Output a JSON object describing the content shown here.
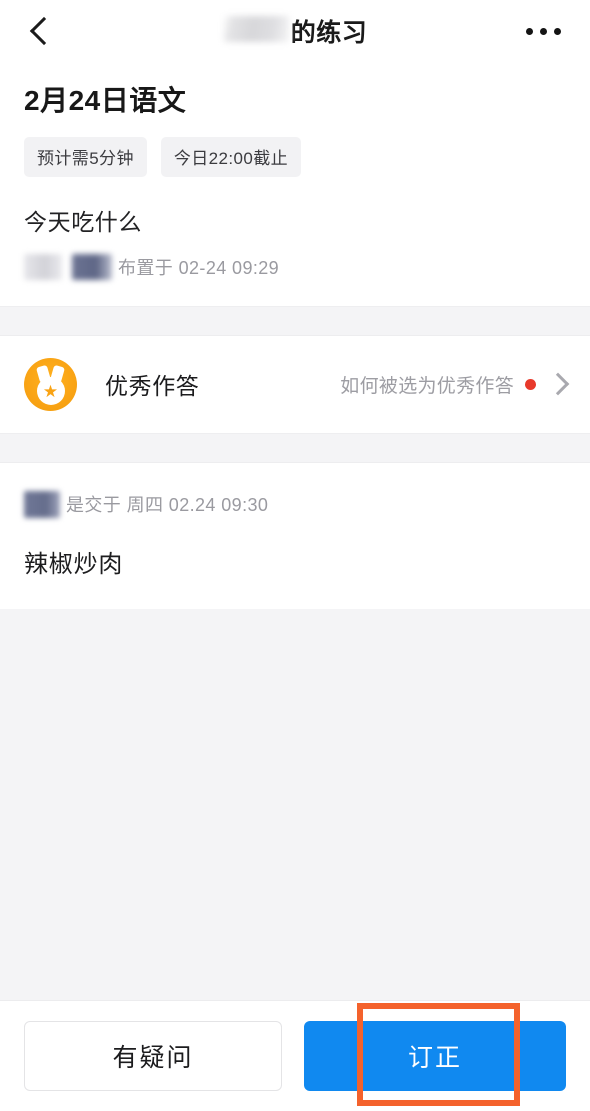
{
  "header": {
    "back_icon": "chevron-left-icon",
    "title_suffix": "的练习",
    "title_blurred_name": "",
    "more_icon": "more-horizontal-icon"
  },
  "assignment": {
    "title": "2月24日语文",
    "chips": [
      "预计需5分钟",
      "今日22:00截止"
    ],
    "question": "今天吃什么",
    "assigned_meta": "布置于 02-24 09:29"
  },
  "excellent": {
    "icon": "medal-star-icon",
    "label": "优秀作答",
    "hint": "如何被选为优秀作答",
    "badge": "red-dot",
    "chevron": "chevron-right-icon"
  },
  "answer": {
    "submitted_meta": "是交于 周四 02.24 09:30",
    "text": "辣椒炒肉"
  },
  "bottom": {
    "secondary_label": "有疑问",
    "primary_label": "订正"
  },
  "colors": {
    "primary_blue": "#1089f0",
    "medal_orange": "#f9a314",
    "badge_red": "#e8392b",
    "annotation_orange": "#f4622c",
    "page_gray": "#f4f4f6"
  }
}
